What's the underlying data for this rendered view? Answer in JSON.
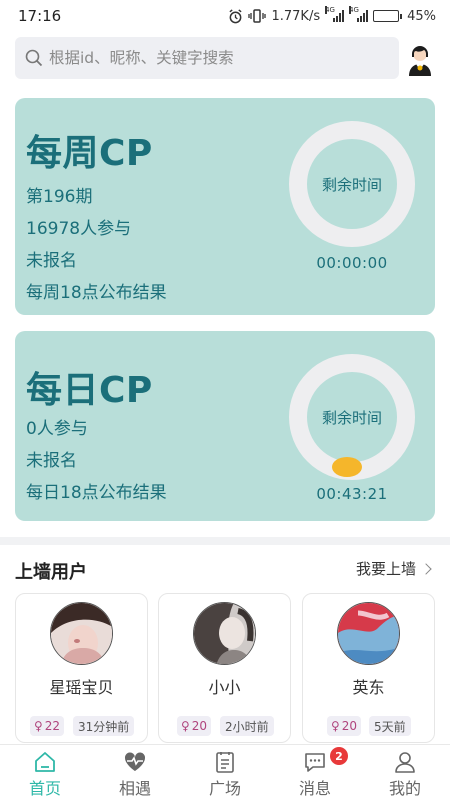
{
  "status_bar": {
    "time": "17:16",
    "net_speed": "1.77K/s",
    "battery": "45%",
    "battery_level": 0.45,
    "signal_tag": "4G"
  },
  "search": {
    "placeholder": "根据id、昵称、关键字搜索"
  },
  "weekly_cp": {
    "title": "每周CP",
    "issue": "第196期",
    "participants": "16978人参与",
    "signup_status": "未报名",
    "announce": "每周18点公布结果",
    "ring_label": "剩余时间",
    "countdown": "00:00:00"
  },
  "daily_cp": {
    "title": "每日CP",
    "participants": "0人参与",
    "signup_status": "未报名",
    "announce": "每日18点公布结果",
    "ring_label": "剩余时间",
    "countdown": "00:43:21"
  },
  "wall": {
    "title": "上墙用户",
    "action": "我要上墙",
    "users": [
      {
        "name": "星瑶宝贝",
        "age": "22",
        "time": "31分钟前"
      },
      {
        "name": "小小",
        "age": "20",
        "time": "2小时前"
      },
      {
        "name": "英东",
        "age": "20",
        "time": "5天前"
      }
    ]
  },
  "tabbar": {
    "tabs": [
      {
        "label": "首页",
        "icon": "home-icon",
        "active": true
      },
      {
        "label": "相遇",
        "icon": "heartbeat-icon"
      },
      {
        "label": "广场",
        "icon": "notes-icon"
      },
      {
        "label": "消息",
        "icon": "message-icon",
        "badge": "2"
      },
      {
        "label": "我的",
        "icon": "profile-icon"
      }
    ]
  },
  "colors": {
    "card_bg": "#b8ded9",
    "card_text": "#1b6f7a",
    "accent": "#2fb8a8",
    "timer_dot": "#f5b62b",
    "badge_red": "#e8393a"
  }
}
